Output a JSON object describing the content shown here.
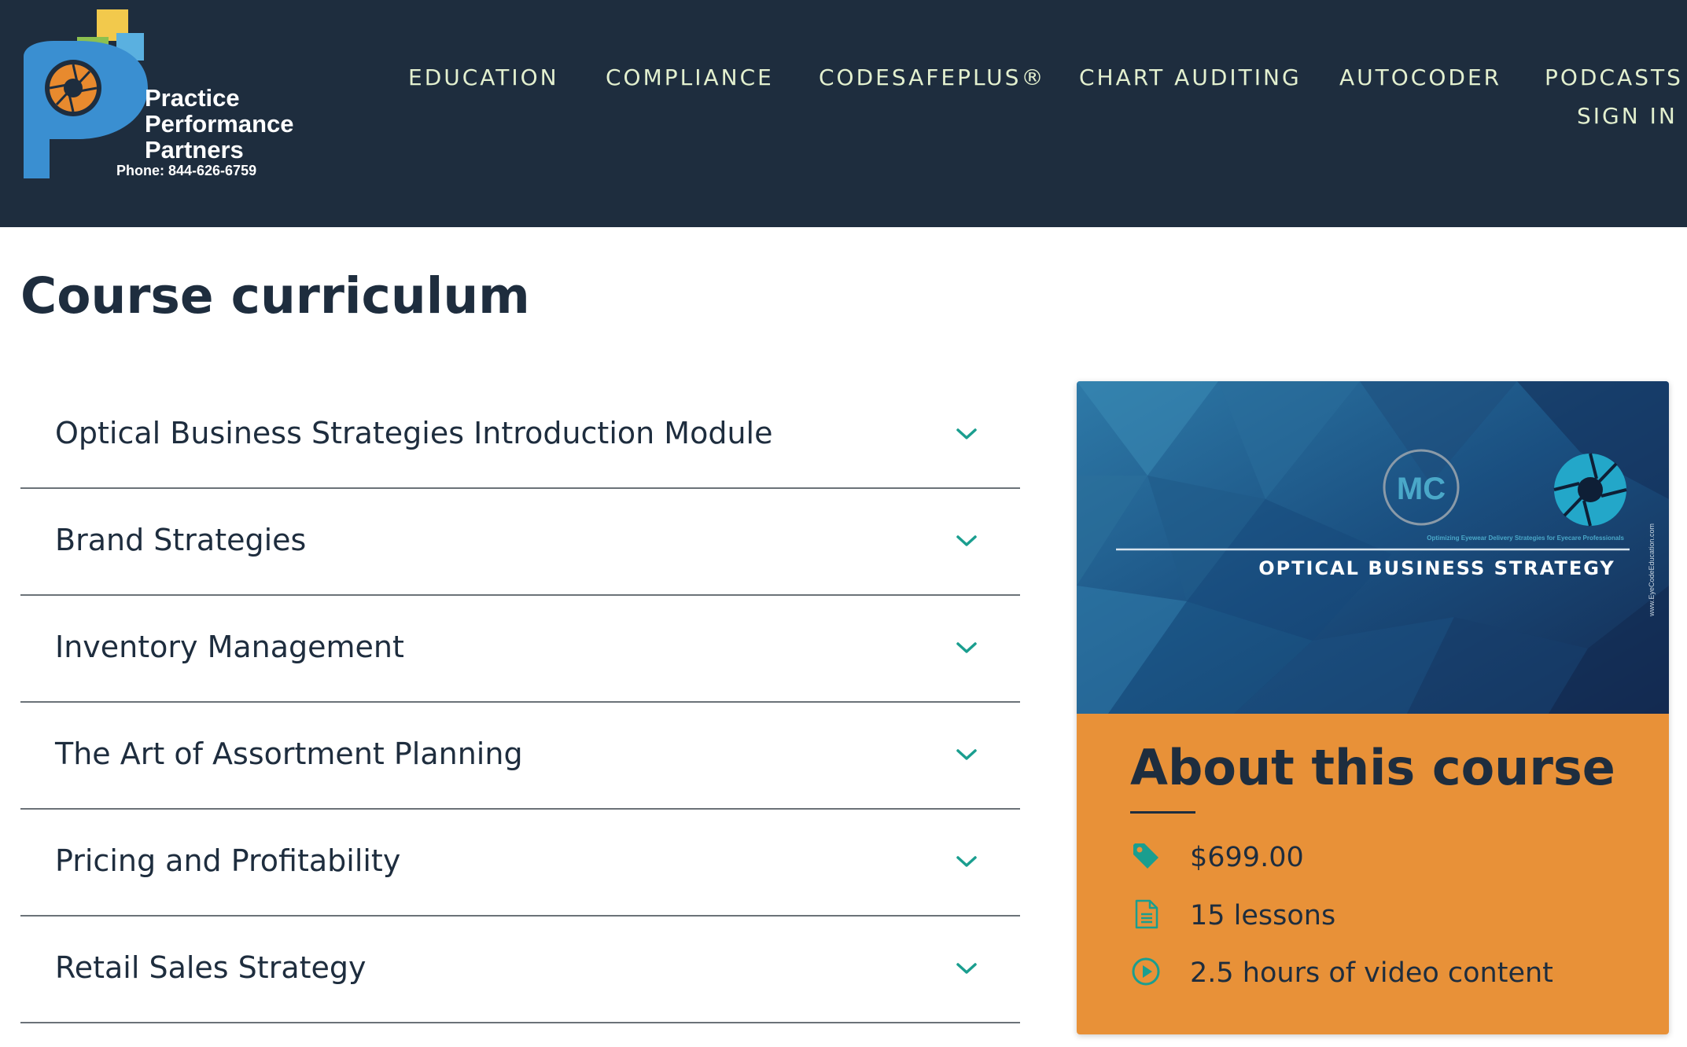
{
  "header": {
    "logo": {
      "line1": "Practice",
      "line2": "Performance",
      "line3": "Partners",
      "phone": "Phone: 844-626-6759"
    },
    "nav": [
      {
        "label": "EDUCATION"
      },
      {
        "label": "COMPLIANCE"
      },
      {
        "label": "CODESAFEPLUS®"
      },
      {
        "label": "CHART AUDITING"
      },
      {
        "label": "AUTOCODER"
      },
      {
        "label": "PODCASTS"
      }
    ],
    "signin_label": "SIGN IN"
  },
  "main": {
    "title": "Course curriculum",
    "sections": [
      {
        "title": "Optical Business Strategies Introduction Module"
      },
      {
        "title": "Brand Strategies"
      },
      {
        "title": "Inventory Management"
      },
      {
        "title": "The Art of Assortment Planning"
      },
      {
        "title": "Pricing and Profitability"
      },
      {
        "title": "Retail Sales Strategy"
      }
    ]
  },
  "card": {
    "image": {
      "logo_text": "MC",
      "tagline": "Optimizing Eyewear Delivery Strategies for Eyecare Professionals",
      "title": "OPTICAL BUSINESS STRATEGY",
      "side_url": "www.EyeCodeEducation.com"
    },
    "about_title": "About this course",
    "facts": [
      {
        "icon": "price-tag-icon",
        "text": "$699.00"
      },
      {
        "icon": "document-icon",
        "text": "15 lessons"
      },
      {
        "icon": "play-circle-icon",
        "text": "2.5 hours of video content"
      }
    ]
  },
  "colors": {
    "header_bg": "#1e2d3e",
    "nav_text": "#e3f0cf",
    "accent_teal": "#1a9e8f",
    "card_orange": "#e89138",
    "card_image_bg": "#1d4e79"
  }
}
